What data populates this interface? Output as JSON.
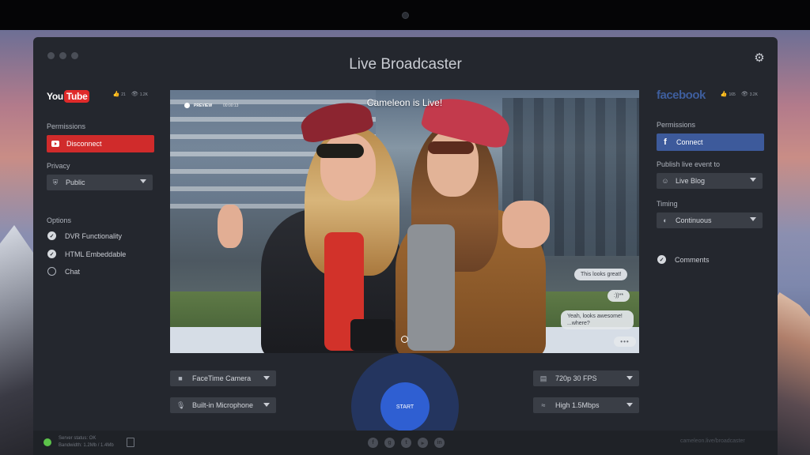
{
  "app": {
    "title": "Live Broadcaster"
  },
  "youtube": {
    "brand_you": "You",
    "brand_tube": "Tube",
    "likes": "21",
    "views": "1.2K",
    "permissions_label": "Permissions",
    "disconnect_label": "Disconnect",
    "privacy_label": "Privacy",
    "privacy_value": "Public",
    "options_label": "Options",
    "options": [
      {
        "label": "DVR Functionality",
        "checked": true
      },
      {
        "label": "HTML Embeddable",
        "checked": true
      },
      {
        "label": "Chat",
        "checked": false
      }
    ]
  },
  "facebook": {
    "brand": "facebook",
    "likes": "165",
    "views": "3.2K",
    "permissions_label": "Permissions",
    "connect_label": "Connect",
    "publish_label": "Publish live event to",
    "publish_value": "Live Blog",
    "timing_label": "Timing",
    "timing_value": "Continuous",
    "comments_label": "Comments"
  },
  "preview": {
    "badge": "PREVIEW",
    "time": "00:00:13",
    "title": "Cameleon is Live!",
    "chat": [
      "This looks great!",
      ":))**",
      "Yeah, looks awesome!",
      "...where?",
      "•••"
    ]
  },
  "controls": {
    "camera": "FaceTime Camera",
    "microphone": "Built-in Microphone",
    "resolution": "720p 30 FPS",
    "bitrate": "High 1.5Mbps",
    "start": "START"
  },
  "footer": {
    "status": "Server status: OK",
    "bandwidth": "Bandwidth: 1.2Mb / 1.4Mb",
    "link": "cameleon.live/broadcaster",
    "social_icons": [
      "facebook-icon",
      "google-plus-icon",
      "twitter-icon",
      "youtube-icon",
      "linkedin-icon"
    ]
  },
  "colors": {
    "window_bg": "#24272e",
    "youtube_red": "#d02b2b",
    "facebook_blue": "#3d5a9b",
    "start_blue": "#2f5fd2",
    "status_green": "#5cc34a"
  }
}
